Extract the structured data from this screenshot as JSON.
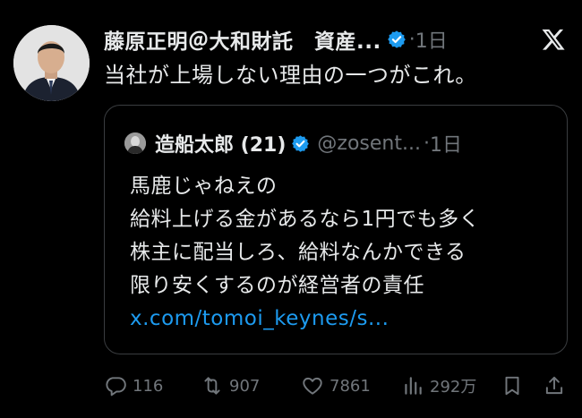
{
  "author": {
    "name": "藤原正明＠大和財託　資産...",
    "time": "1日"
  },
  "tweet_text": "当社が上場しない理由の一つがこれ。",
  "quoted": {
    "name": "造船太郎 (21)",
    "handle": "@zosent...",
    "time": "1日",
    "lines": [
      "馬鹿じゃねえの",
      "給料上げる金があるなら1円でも多く",
      "株主に配当しろ、給料なんかできる",
      "限り安くするのが経営者の責任"
    ],
    "link": "x.com/tomoi_keynes/s..."
  },
  "actions": {
    "replies": "116",
    "retweets": "907",
    "likes": "7861",
    "views": "292万"
  },
  "icons": {
    "verified": "verified-badge-icon",
    "logo": "x-logo-icon",
    "reply": "reply-icon",
    "retweet": "retweet-icon",
    "like": "heart-icon",
    "views": "views-icon",
    "bookmark": "bookmark-icon",
    "share": "share-icon"
  },
  "colors": {
    "background": "#000000",
    "text": "#e7e9ea",
    "muted": "#71767b",
    "link": "#1d9bf0",
    "border": "#3a3d40"
  }
}
